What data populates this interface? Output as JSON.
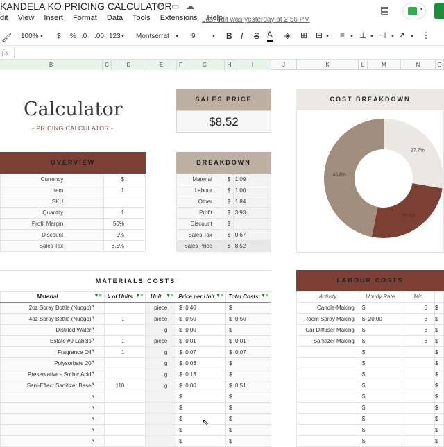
{
  "app": {
    "doc_title": "KANDELA KO PRICING CALCULATOR",
    "last_edit": "Last edit was yesterday at 2:56 PM",
    "menu": [
      "dit",
      "View",
      "Insert",
      "Format",
      "Data",
      "Tools",
      "Extensions",
      "Help"
    ],
    "toolbar": {
      "zoom": "100%",
      "currency": "$",
      "percent": "%",
      "dec_less": ".0",
      "dec_more": ".00",
      "format_more": "123",
      "font": "Montserrat",
      "font_size": "9",
      "bold": "B",
      "italic": "I",
      "strike": "S",
      "text_color": "A"
    },
    "fx": "fx",
    "columns": [
      "B",
      "C",
      "D",
      "E",
      "F",
      "G",
      "H",
      "I",
      "J",
      "K",
      "L",
      "M",
      "N",
      "O"
    ]
  },
  "calculator": {
    "title": "Calculator",
    "subtitle": "- PRICING CALCULATOR -"
  },
  "sales_price": {
    "label": "SALES PRICE",
    "value": "$8.52"
  },
  "overview": {
    "label": "OVERVIEW",
    "rows": [
      {
        "k": "Currency",
        "v": "$"
      },
      {
        "k": "Item",
        "v": "1"
      },
      {
        "k": "SKU",
        "v": ""
      },
      {
        "k": "Quantity",
        "v": "1"
      },
      {
        "k": "Profit Margin",
        "v": "50%"
      },
      {
        "k": "Discount",
        "v": "0%"
      },
      {
        "k": "Sales Tax",
        "v": "8.5%"
      }
    ]
  },
  "breakdown": {
    "label": "BREAKDOWN",
    "rows": [
      {
        "k": "Material",
        "c": "$",
        "v": "1.09"
      },
      {
        "k": "Labour",
        "c": "$",
        "v": "1.00"
      },
      {
        "k": "Other",
        "c": "$",
        "v": "1.84"
      },
      {
        "k": "Profit",
        "c": "$",
        "v": "3.93"
      },
      {
        "k": "Discount",
        "c": "$",
        "v": ""
      },
      {
        "k": "Sales Tax",
        "c": "$",
        "v": "0.67"
      },
      {
        "k": "Sales Price",
        "c": "$",
        "v": "8.52"
      }
    ]
  },
  "cost_breakdown": {
    "label": "COST BREAKDOWN",
    "slices": [
      {
        "label": "27.7%",
        "value": 27.7,
        "color": "#ebe7e3"
      },
      {
        "label": "25.5%",
        "value": 25.5,
        "color": "#7b3f34"
      },
      {
        "label": "46.8%",
        "value": 46.8,
        "color": "#a08d7e"
      }
    ]
  },
  "materials": {
    "label": "MATERIALS COSTS",
    "headers": [
      "Material",
      "# of Units",
      "Unit",
      "Price per Unit",
      "Total Costs"
    ],
    "rows": [
      [
        "2oz Spray Bottle (Nuogo)",
        "",
        "piece",
        "0.40",
        ""
      ],
      [
        "4oz Spray Bottle (Nuogo)",
        "1",
        "piece",
        "0.50",
        "0.50"
      ],
      [
        "Distilled Water",
        "",
        "g",
        "0.00",
        ""
      ],
      [
        "Estate #9 Labels",
        "1",
        "piece",
        "0.01",
        "0.01"
      ],
      [
        "Fragrance Oil",
        "1",
        "g",
        "0.07",
        "0.07"
      ],
      [
        "Polysorbate 20",
        "",
        "g",
        "0.03",
        ""
      ],
      [
        "Preservative - Sorbic Acid",
        "",
        "g",
        "0.13",
        ""
      ],
      [
        "Sani-Effect Sanitizer Base",
        "110",
        "g",
        "0.00",
        "0.51"
      ],
      [
        "",
        "",
        "",
        "",
        ""
      ],
      [
        "",
        "",
        "",
        "",
        ""
      ],
      [
        "",
        "",
        "",
        "",
        ""
      ],
      [
        "",
        "",
        "",
        "",
        ""
      ],
      [
        "",
        "",
        "",
        "",
        ""
      ]
    ]
  },
  "labour": {
    "label": "LABOUR COSTS",
    "headers": [
      "Activity",
      "Hourly Rate",
      "Min"
    ],
    "rows": [
      [
        "Candle-Making",
        "",
        "5"
      ],
      [
        "Room Spray Making",
        "20.00",
        "3"
      ],
      [
        "Car Diffuser Making",
        "",
        "3"
      ],
      [
        "Sanitizer Making",
        "",
        "3"
      ],
      [
        "",
        "",
        ""
      ],
      [
        "",
        "",
        ""
      ],
      [
        "",
        "",
        ""
      ],
      [
        "",
        "",
        ""
      ],
      [
        "",
        "",
        ""
      ],
      [
        "",
        "",
        ""
      ],
      [
        "",
        "",
        ""
      ],
      [
        "",
        "",
        ""
      ],
      [
        "",
        "",
        ""
      ]
    ]
  }
}
